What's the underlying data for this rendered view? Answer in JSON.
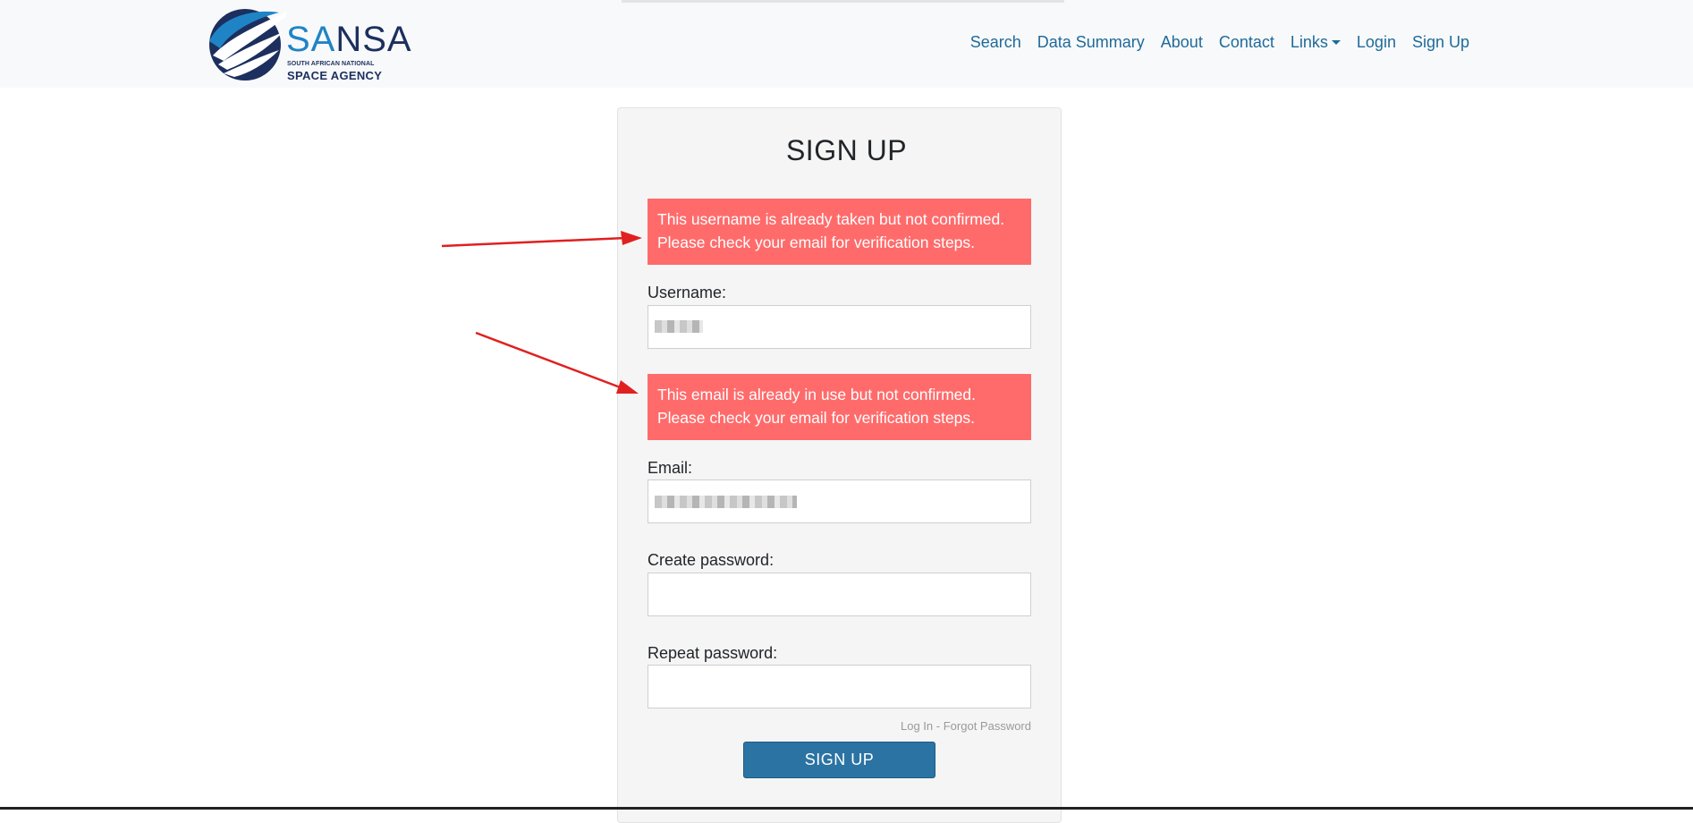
{
  "brand": {
    "logo_word_part1": "SA",
    "logo_word_part2": "NSA",
    "logo_subtitle_line1": "SOUTH AFRICAN NATIONAL",
    "logo_subtitle_line2": "SPACE AGENCY",
    "accent_color": "#1f84c6",
    "dark_color": "#1c2f5e"
  },
  "nav": {
    "links": [
      {
        "label": "Search"
      },
      {
        "label": "Data Summary"
      },
      {
        "label": "About"
      },
      {
        "label": "Contact"
      },
      {
        "label": "Links"
      },
      {
        "label": "Login"
      },
      {
        "label": "Sign Up"
      }
    ],
    "link_color": "#1f6a9a"
  },
  "form": {
    "title": "SIGN UP",
    "username_error_line1": "This username is already taken but not confirmed.",
    "username_error_line2": "Please check your email for verification steps.",
    "username_label": "Username:",
    "email_error_line1": "This email is already in use but not confirmed.",
    "email_error_line2": "Please check your email for verification steps.",
    "email_label": "Email:",
    "password_label": "Create password:",
    "repeat_password_label": "Repeat password:",
    "login_link": "Log In",
    "separator": "-",
    "forgot_link": "Forgot Password",
    "submit_label": "SIGN UP",
    "error_color": "#ff6b6b",
    "button_color": "#2b73a3"
  },
  "annotations": {
    "arrow_color": "#e02020"
  }
}
